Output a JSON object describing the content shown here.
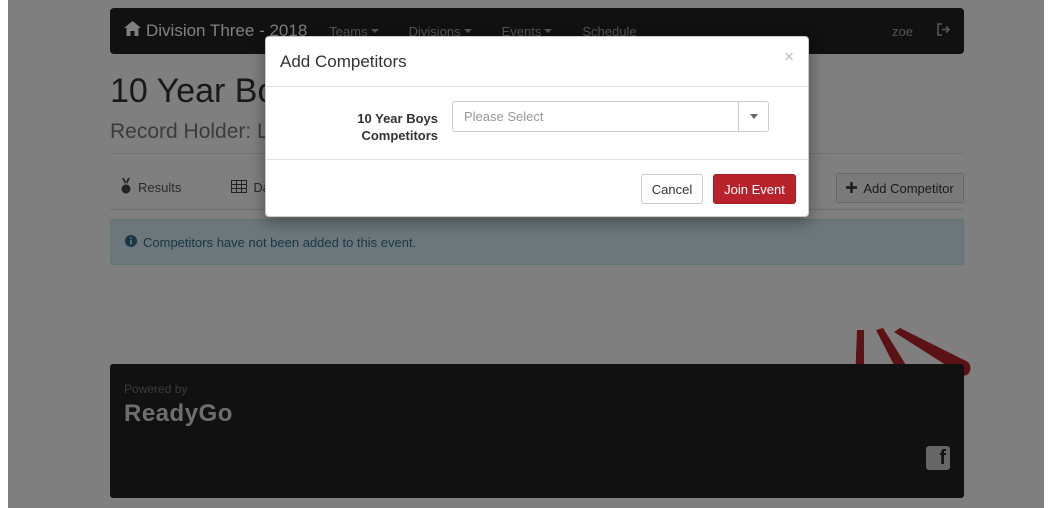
{
  "nav": {
    "brand": "Division Three - 2018",
    "items": [
      {
        "label": "Teams"
      },
      {
        "label": "Divisions"
      },
      {
        "label": "Events"
      },
      {
        "label": "Schedule"
      }
    ],
    "user": "zoe"
  },
  "page": {
    "title": "10 Year Bo",
    "subtitle": "Record Holder: L",
    "tabs": [
      {
        "label": "Results",
        "icon": "medal-icon"
      },
      {
        "label": "Dat",
        "icon": "table-icon"
      }
    ],
    "add_competitor_label": "Add Competitor",
    "alert_text": "Competitors have not been added to this event."
  },
  "footer": {
    "powered_by": "Powered by",
    "logo": "ReadyGo"
  },
  "modal": {
    "title": "Add Competitors",
    "close_glyph": "×",
    "field_label_line1": "10 Year Boys",
    "field_label_line2": "Competitors",
    "select_placeholder": "Please Select",
    "cancel_label": "Cancel",
    "join_label": "Join Event"
  },
  "colors": {
    "accent_red": "#b8222b",
    "navbar": "#222222",
    "alert_bg": "#d9edf7"
  }
}
